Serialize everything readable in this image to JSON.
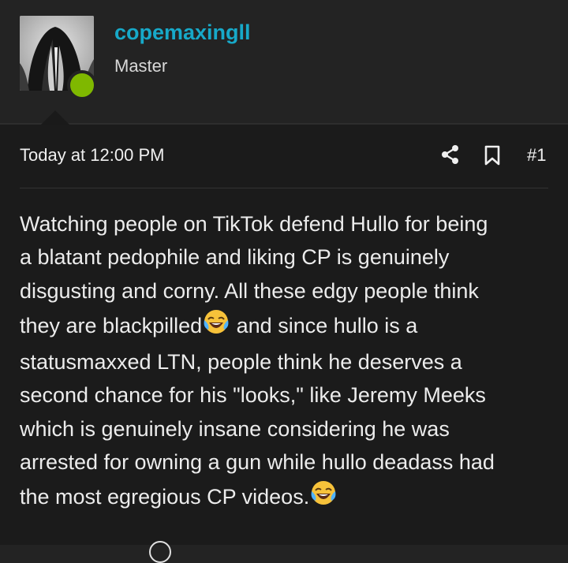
{
  "post": {
    "author": {
      "username": "copemaxingll",
      "rank": "Master",
      "online_color": "#7fb800",
      "username_color": "#17a9c9"
    },
    "timestamp": "Today at 12:00 PM",
    "post_number": "#1",
    "actions": {
      "share_icon": "share-icon",
      "bookmark_icon": "bookmark-icon"
    },
    "message_lines": [
      "Watching people on TikTok defend Hullo for being",
      "a blatant pedophile and liking CP is genuinely",
      "disgusting and corny. All these edgy people think",
      "they are blackpilled",
      " and since hullo is a",
      "statusmaxxed LTN, people think he deserves a",
      "second chance for his \"looks,\" like Jeremy Meeks",
      "which is genuinely insane considering he was",
      "arrested for owning a gun while hullo deadass had",
      "the most egregious CP videos."
    ],
    "emoji": "face-with-tears-of-joy"
  }
}
